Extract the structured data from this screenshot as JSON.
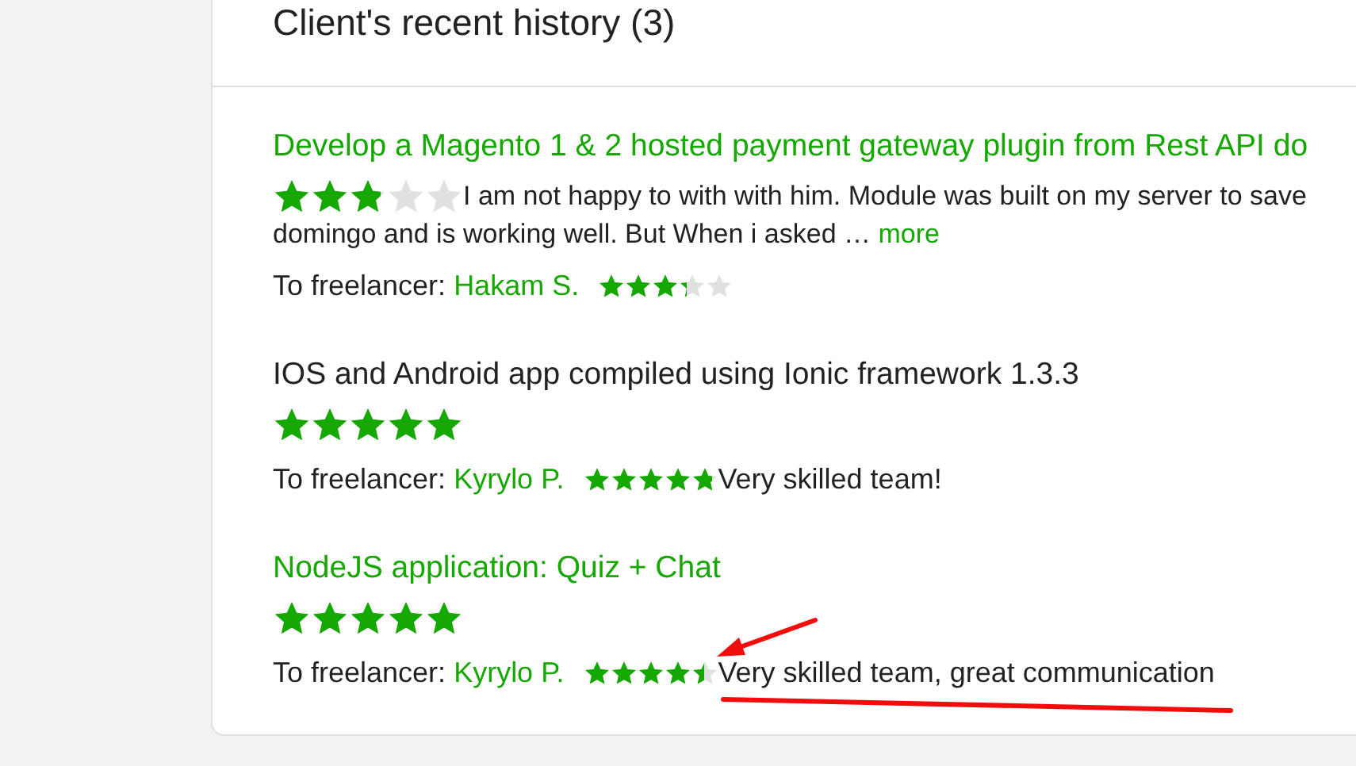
{
  "section": {
    "title": "Client's recent history (3)"
  },
  "jobs": [
    {
      "title": "Develop a Magento 1 & 2 hosted payment gateway plugin from Rest API do",
      "linked": true,
      "stars": 2.85,
      "comment_lines": [
        "I am not happy to with with him. Module was built on my server to save",
        "domingo and is working well. But When i asked …"
      ],
      "more": "more",
      "freelancer_label": "To freelancer:",
      "freelancer": "Hakam S.",
      "freelancer_rating": {
        "stars": 3.3
      }
    },
    {
      "title": "IOS and Android app compiled using Ionic framework 1.3.3",
      "linked": false,
      "stars": 5,
      "freelancer_label": "To freelancer:",
      "freelancer": "Kyrylo P.",
      "freelancer_rating": {
        "stars": 4.8
      },
      "feedback": "Very skilled team!"
    },
    {
      "title": "NodeJS application: Quiz + Chat",
      "linked": true,
      "stars": 5,
      "freelancer_label": "To freelancer:",
      "freelancer": "Kyrylo P.",
      "freelancer_rating": {
        "stars": 4.5
      },
      "feedback": "Very skilled team, great communication"
    }
  ]
}
